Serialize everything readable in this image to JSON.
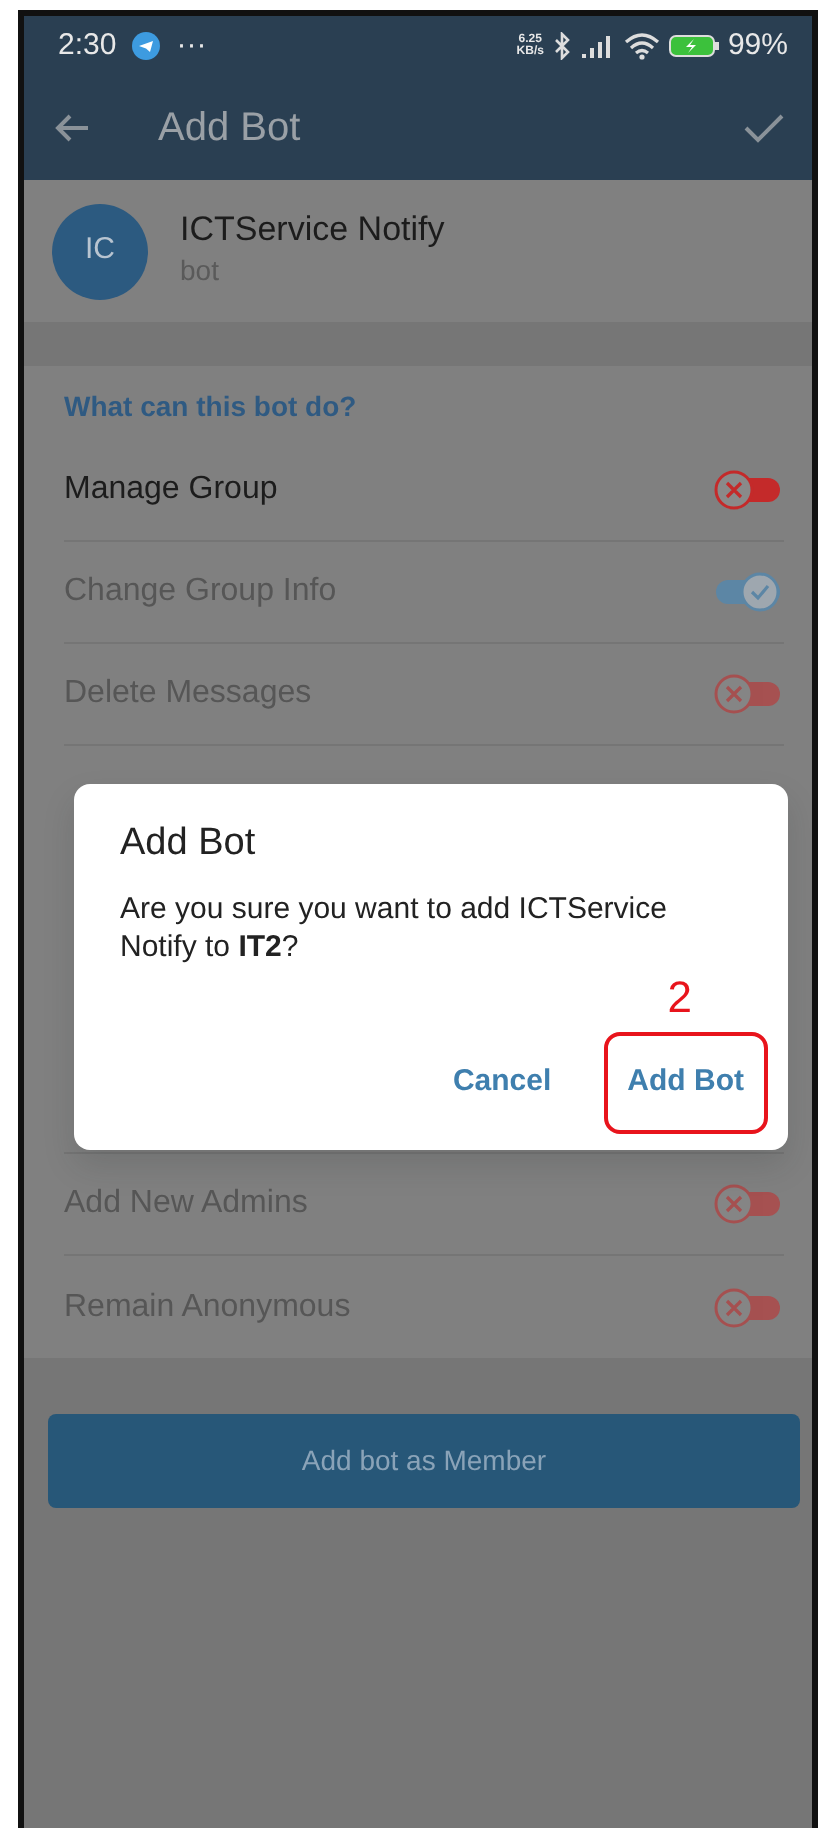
{
  "status_bar": {
    "time": "2:30",
    "more": "···",
    "speed_value": "6.25",
    "speed_unit": "KB/s",
    "battery": "99%"
  },
  "app_bar": {
    "title": "Add Bot"
  },
  "bot": {
    "initials": "IC",
    "name": "ICTService Notify",
    "subtitle": "bot"
  },
  "section_title": "What can this bot do?",
  "permissions_top": [
    {
      "label": "Manage Group",
      "on": false,
      "disabled": false
    },
    {
      "label": "Change Group Info",
      "on": true,
      "disabled": true
    },
    {
      "label": "Delete Messages",
      "on": false,
      "disabled": true
    }
  ],
  "permissions_bottom": [
    {
      "label": "Add New Admins",
      "on": false,
      "disabled": true
    },
    {
      "label": "Remain Anonymous",
      "on": false,
      "disabled": true
    }
  ],
  "primary_button": "Add bot as Member",
  "dialog": {
    "title": "Add Bot",
    "message": "Are you sure you want to add ICTService Notify to **IT2**?",
    "buttons": [
      {
        "label": "Cancel",
        "highlighted": false
      },
      {
        "label": "Add Bot",
        "highlighted": true
      }
    ],
    "annotation": "2"
  }
}
